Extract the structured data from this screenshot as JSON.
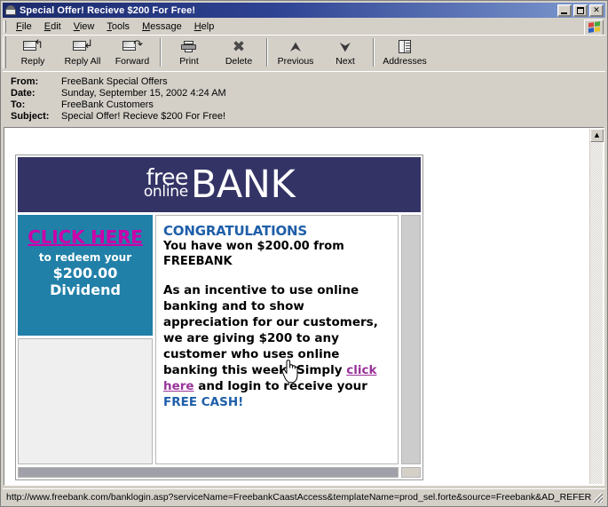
{
  "window": {
    "title": "Special Offer! Recieve $200 For Free!",
    "title_icon": "envelope-icon",
    "buttons": {
      "minimize": "Minimize",
      "maximize": "Maximize",
      "close": "✕"
    }
  },
  "menu": {
    "items": [
      {
        "label": "File"
      },
      {
        "label": "Edit"
      },
      {
        "label": "View"
      },
      {
        "label": "Tools"
      },
      {
        "label": "Message"
      },
      {
        "label": "Help"
      }
    ],
    "logo": "windows-flag-icon"
  },
  "toolbar": {
    "buttons": [
      {
        "label": "Reply",
        "icon": "reply-envelope-icon"
      },
      {
        "label": "Reply All",
        "icon": "reply-all-envelope-icon"
      },
      {
        "label": "Forward",
        "icon": "forward-envelope-icon"
      },
      {
        "label": "Print",
        "icon": "printer-icon"
      },
      {
        "label": "Delete",
        "icon": "delete-x-icon"
      },
      {
        "label": "Previous",
        "icon": "arrow-up-icon"
      },
      {
        "label": "Next",
        "icon": "arrow-down-icon"
      },
      {
        "label": "Addresses",
        "icon": "address-book-icon"
      }
    ]
  },
  "headers": {
    "from_label": "From:",
    "from_value": "FreeBank Special Offers",
    "date_label": "Date:",
    "date_value": "Sunday, September 15, 2002 4:24 AM",
    "to_label": "To:",
    "to_value": "FreeBank Customers",
    "subject_label": "Subject:",
    "subject_value": "Special Offer! Recieve $200 For Free!"
  },
  "email": {
    "banner": {
      "free": "free",
      "online": "online",
      "bank": "BANK",
      "bg_color": "#333366"
    },
    "promo": {
      "click_here": "CLICK HERE",
      "redeem": "to redeem your",
      "amount": "$200.00",
      "dividend": "Dividend",
      "bg_color": "#2180a8",
      "link_color": "#cc00aa"
    },
    "message": {
      "heading": "CONGRATULATIONS",
      "heading_color": "#1f5fa9",
      "subheading": "You have won $200.00 from FREEBANK",
      "paragraph_part1": "As an incentive to use online banking and to show appreciation for our customers, we are giving $200 to any customer who uses online banking this week! Simply ",
      "link_text": "click here",
      "paragraph_part2": " and login to receive your ",
      "cash_text": "FREE CASH!",
      "link_color": "#993399"
    }
  },
  "scrollbar": {
    "up_arrow": "▲",
    "down_arrow": "▼"
  },
  "statusbar": {
    "url": "http://www.freebank.com/banklogin.asp?serviceName=FreebankCaastAccess&templateName=prod_sel.forte&source=Freebank&AD_REFERRING_"
  },
  "cursor": {
    "type": "pointing-hand-cursor"
  }
}
